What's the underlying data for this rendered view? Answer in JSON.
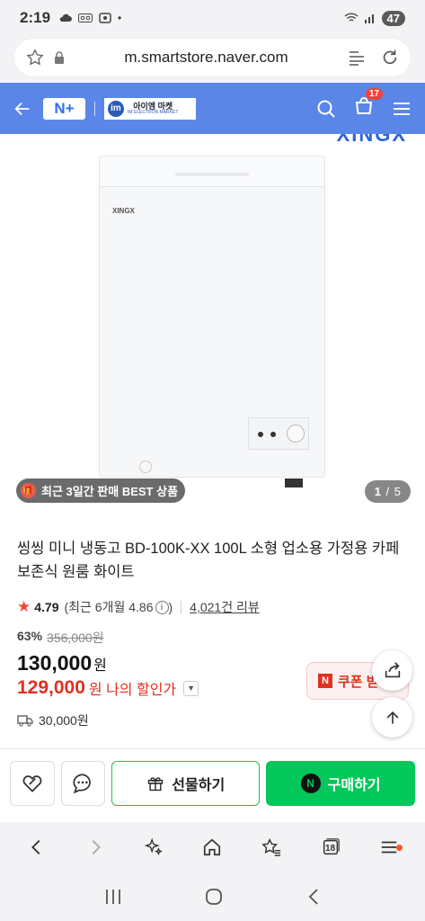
{
  "status_bar": {
    "time": "2:19",
    "battery": "47"
  },
  "browser": {
    "url": "m.smartstore.naver.com"
  },
  "app_header": {
    "naver_plus_label": "N+",
    "store_logo_main": "아이엠 마켓",
    "store_logo_sub": "IM ELECTRON MARKET",
    "store_logo_circle": "im",
    "cart_count": "17",
    "accent_color": "#5a86e8"
  },
  "gallery": {
    "brand_watermark": "XINGX",
    "freezer_brand": "XINGX",
    "best_badge": "최근 3일간 판매 BEST 상품",
    "current_index": "1",
    "total": "5"
  },
  "product": {
    "title": "씽씽 미니 냉동고 BD-100K-XX 100L 소형 업소용 가정용 카페 보존식 원룸 화이트",
    "rating": "4.79",
    "recent_rating": "(최근 6개월 4.86",
    "recent_rating_close": ")",
    "review_count": "4,021건 리뷰",
    "discount_rate": "63%",
    "original_price": "356,000원",
    "price": "130,000",
    "price_unit": "원",
    "my_price": "129,000",
    "my_price_label": "원  나의 할인가",
    "shipping": "30,000원",
    "coupon_label": "쿠폰 받기"
  },
  "actions": {
    "gift_label": "선물하기",
    "buy_label": "구매하기",
    "buy_color": "#03c75a"
  },
  "browser_nav": {
    "tabs_count": "18"
  }
}
